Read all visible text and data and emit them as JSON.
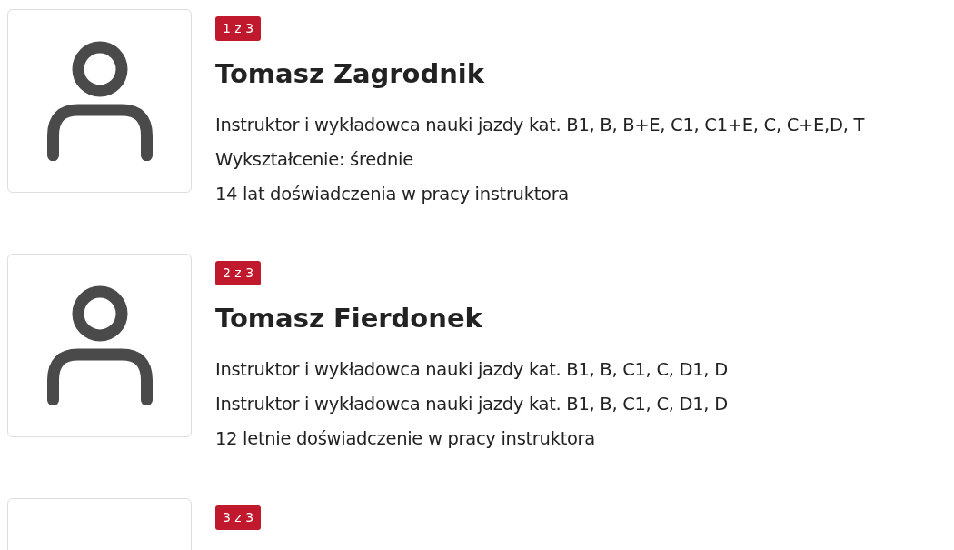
{
  "instructors": [
    {
      "badge": "1 z 3",
      "avatar": true,
      "name": "Tomasz Zagrodnik",
      "lines": [
        "Instruktor i wykładowca nauki jazdy kat. B1, B, B+E, C1, C1+E, C, C+E,D, T",
        "Wykształcenie: średnie",
        "14 lat doświadczenia w pracy instruktora"
      ]
    },
    {
      "badge": "2 z 3",
      "avatar": true,
      "name": "Tomasz Fierdonek",
      "lines": [
        "Instruktor i wykładowca nauki jazdy kat. B1, B, C1, C, D1, D",
        "Instruktor i wykładowca nauki jazdy kat. B1, B, C1, C, D1, D",
        "12 letnie doświadczenie w pracy instruktora"
      ]
    },
    {
      "badge": "3 z 3",
      "avatar": false
    }
  ]
}
